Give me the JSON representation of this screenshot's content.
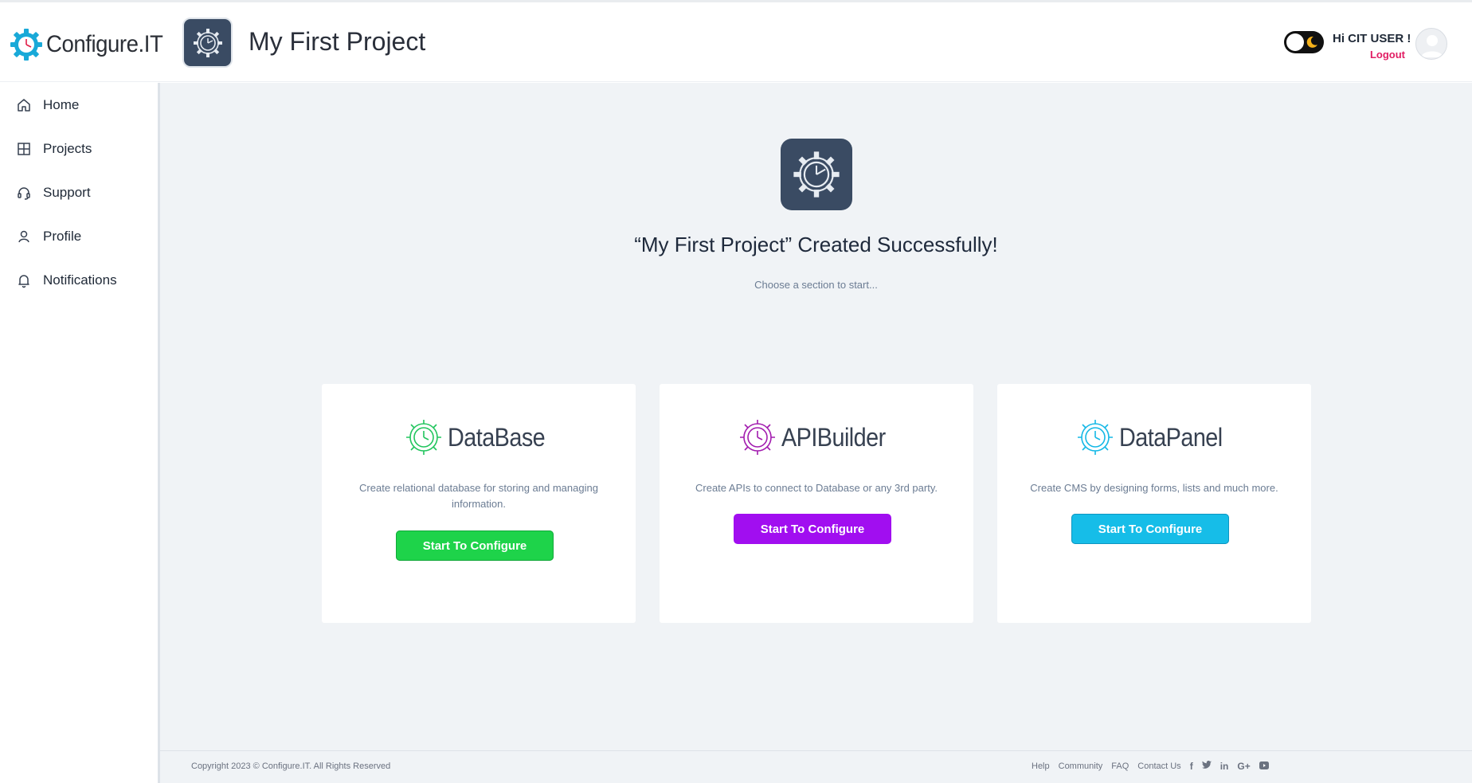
{
  "brand": {
    "logo_text": "Configure.IT"
  },
  "header": {
    "project_title": "My First Project",
    "greeting": "Hi CIT USER !",
    "logout": "Logout"
  },
  "sidebar": {
    "items": [
      {
        "label": "Home",
        "icon": "home-icon"
      },
      {
        "label": "Projects",
        "icon": "grid-icon"
      },
      {
        "label": "Support",
        "icon": "headset-icon"
      },
      {
        "label": "Profile",
        "icon": "user-icon"
      },
      {
        "label": "Notifications",
        "icon": "bell-icon"
      }
    ]
  },
  "main": {
    "success_message": "“My First Project” Created Successfully!",
    "subtitle": "Choose a section to start...",
    "cards": [
      {
        "name": "DataBase",
        "description": "Create relational database for storing and managing information.",
        "button": "Start To Configure",
        "color": "#1ed34a"
      },
      {
        "name": "APIBuilder",
        "description": "Create APIs to connect to Database or any 3rd party.",
        "button": "Start To Configure",
        "color": "#a10ef0"
      },
      {
        "name": "DataPanel",
        "description": "Create CMS by designing forms, lists and much more.",
        "button": "Start To Configure",
        "color": "#16bde8"
      }
    ]
  },
  "footer": {
    "copyright": "Copyright 2023 © Configure.IT. All Rights Reserved",
    "links": [
      "Help",
      "Community",
      "FAQ",
      "Contact Us"
    ],
    "social": [
      "facebook-icon",
      "twitter-icon",
      "linkedin-icon",
      "google-plus-icon",
      "youtube-icon"
    ]
  },
  "colors": {
    "accent_pink": "#e11d63",
    "main_bg": "#f0f3f6",
    "icon_tile": "#3a4b63"
  }
}
